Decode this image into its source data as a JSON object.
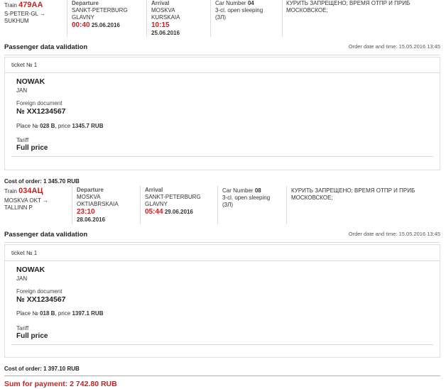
{
  "orders": [
    {
      "train_label": "Train",
      "train_number": "479AA",
      "route": [
        "S-PETER-GL →",
        "SUKHUM"
      ],
      "departure": {
        "label": "Departure",
        "station": [
          "SANKT-PETERBURG",
          "GLAVNY"
        ],
        "time": "00:40",
        "date": "25.06.2016"
      },
      "arrival": {
        "label": "Arrival",
        "station": [
          "MOSKVA",
          "KURSKAIA"
        ],
        "time": "10:15",
        "date": "25.06.2016"
      },
      "car": {
        "label": "Car Number",
        "number": "04",
        "class": "3-cl. open sleeping",
        "code": "(3Л)"
      },
      "notes": "КУРИТЬ ЗАПРЕЩЕНО; ВРЕМЯ ОТПР И ПРИБ МОСКОВСКОЕ;",
      "validation_title": "Passenger data validation",
      "order_date": "Order date and time: 15.05.2016 13:45",
      "ticket": {
        "ticket_label": "ticket № 1",
        "surname": "NOWAK",
        "name": "JAN",
        "doc_label": "Foreign document",
        "doc_number": "№ XX1234567",
        "place_prefix": "Place №",
        "place": "028 B",
        "price_prefix": ", price",
        "price": "1345.7 RUB",
        "tariff_label": "Tariff",
        "tariff": "Full price"
      },
      "cost": "Cost of order: 1 345.70 RUB"
    },
    {
      "train_label": "Train",
      "train_number": "034АЦ",
      "route": [
        "MOSKVA OKT →",
        "TALLINN P"
      ],
      "departure": {
        "label": "Departure",
        "station": [
          "MOSKVA",
          "OKTIABRSKAIA"
        ],
        "time": "23:10",
        "date": "28.06.2016"
      },
      "arrival": {
        "label": "Arrival",
        "station": [
          "SANKT-PETERBURG",
          "GLAVNY"
        ],
        "time": "05:44",
        "date": "29.06.2016"
      },
      "car": {
        "label": "Car Number",
        "number": "08",
        "class": "3-cl. open sleeping",
        "code": "(3Л)"
      },
      "notes": "КУРИТЬ ЗАПРЕЩЕНО; ВРЕМЯ ОТПР И ПРИБ МОСКОВСКОЕ;",
      "validation_title": "Passenger data validation",
      "order_date": "Order date and time: 15.05.2016 13:45",
      "ticket": {
        "ticket_label": "ticket № 1",
        "surname": "NOWAK",
        "name": "JAN",
        "doc_label": "Foreign document",
        "doc_number": "№ XX1234567",
        "place_prefix": "Place №",
        "place": "018 B",
        "price_prefix": ", price",
        "price": "1397.1 RUB",
        "tariff_label": "Tariff",
        "tariff": "Full price"
      },
      "cost": "Cost of order: 1 397.10 RUB"
    }
  ],
  "sum_for_payment": "Sum for payment: 2 742.80 RUB",
  "colors": {
    "accent": "#cc1f1f",
    "border": "#dcdcdc"
  }
}
